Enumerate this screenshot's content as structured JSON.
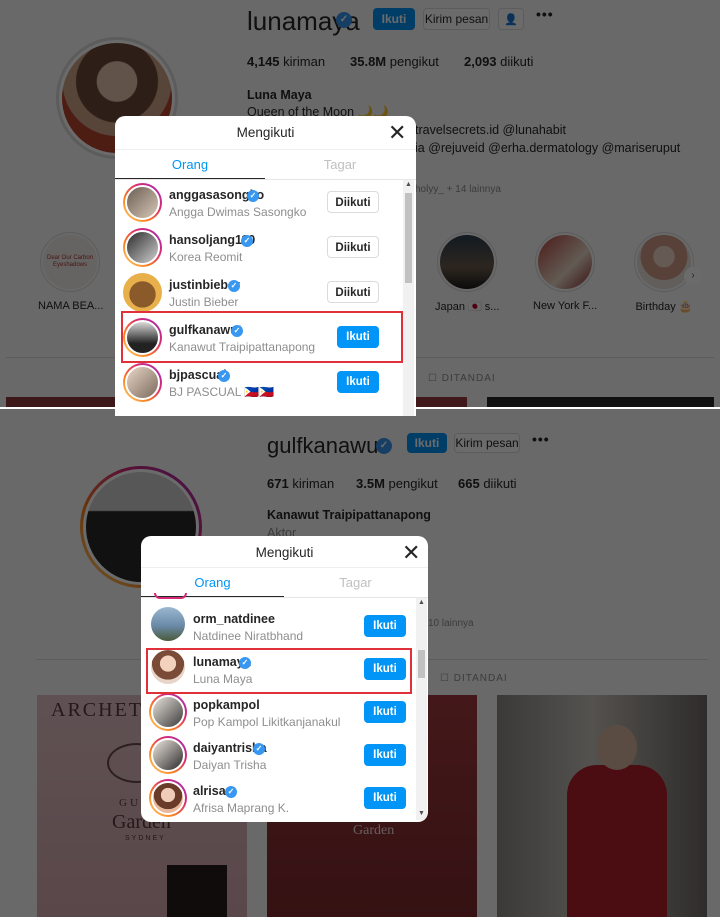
{
  "top_profile": {
    "username": "lunamaya",
    "follow_label": "Ikuti",
    "message_label": "Kirim pesan",
    "more_label": "•••",
    "stats": {
      "posts": "4,145",
      "posts_label": "kiriman",
      "followers": "35.8M",
      "followers_label": "pengikut",
      "following": "2,093",
      "following_label": "diikuti"
    },
    "full_name": "Luna Maya",
    "bio_line1": "Queen of the Moon 🌙🌙",
    "bio_line2": "travelsecrets.id @lunahabit",
    "bio_line3": "ia @rejuveid @erha.dermatology @mariseruput",
    "followed_by": "holyy_ + 14 lainnya",
    "highlights": [
      "NAMA BEA...",
      "Japan 🇯🇵 s...",
      "New York F...",
      "Birthday 🎂"
    ],
    "highlight_card_text": "Dear Our Carbon Eyeshadows",
    "tab_tagged": "DITANDAI"
  },
  "top_modal": {
    "title": "Mengikuti",
    "tab_people": "Orang",
    "tab_hashtags": "Tagar",
    "rows": [
      {
        "username": "anggasasongko",
        "name": "Angga Dwimas Sasongko",
        "button": "Diikuti"
      },
      {
        "username": "hansoljang110",
        "name": "Korea Reomit",
        "button": "Diikuti"
      },
      {
        "username": "justinbieber",
        "name": "Justin Bieber",
        "button": "Diikuti"
      },
      {
        "username": "gulfkanawut",
        "name": "Kanawut Traipipattanapong",
        "button": "Ikuti"
      },
      {
        "username": "bjpascual",
        "name": "BJ PASCUAL 🇵🇭🇵🇭",
        "button": "Ikuti"
      }
    ]
  },
  "bottom_profile": {
    "username": "gulfkanawut",
    "follow_label": "Ikuti",
    "message_label": "Kirim pesan",
    "more_label": "•••",
    "stats": {
      "posts": "671",
      "posts_label": "kiriman",
      "followers": "3.5M",
      "followers_label": "pengikut",
      "following": "665",
      "following_label": "diikuti"
    },
    "full_name": "Kanawut Traipipattanapong",
    "bio_line1": "Aktor",
    "followed_by": "10 lainnya",
    "tab_tagged": "DITANDAI",
    "post_text_1": "ARCHET",
    "post_text_2": "GUCCI",
    "post_text_3": "Garden",
    "post_text_4": "SYDNEY"
  },
  "bottom_modal": {
    "title": "Mengikuti",
    "tab_people": "Orang",
    "tab_hashtags": "Tagar",
    "rows": [
      {
        "username": "orm_natdinee",
        "name": "Natdinee Niratbhand",
        "button": "Ikuti"
      },
      {
        "username": "lunamaya",
        "name": "Luna Maya",
        "button": "Ikuti"
      },
      {
        "username": "popkampol",
        "name": "Pop Kampol Likitkanjanakul",
        "button": "Ikuti"
      },
      {
        "username": "daiyantrisha",
        "name": "Daiyan Trisha",
        "button": "Ikuti"
      },
      {
        "username": "alrisaa",
        "name": "Afrisa Maprang K.",
        "button": "Ikuti"
      }
    ]
  },
  "icons": {
    "verified": "verified-badge-icon",
    "close": "close-icon",
    "add_user": "add-user-icon",
    "tagged": "tagged-icon",
    "chevron": "chevron-right-icon"
  },
  "colors": {
    "accent": "#0095f6",
    "verified": "#3897f0",
    "highlight_box": "#e0313a"
  }
}
